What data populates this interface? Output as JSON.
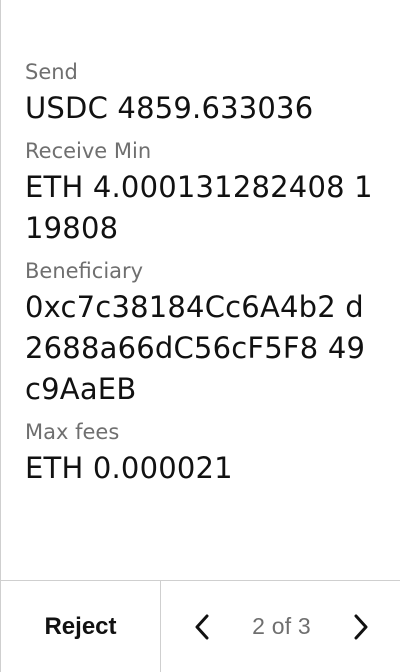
{
  "transaction": {
    "fields": [
      {
        "label": "Send",
        "value": "USDC 4859.633036"
      },
      {
        "label": "Receive Min",
        "value": "ETH 4.000131282408 119808"
      },
      {
        "label": "Beneficiary",
        "value": "0xc7c38184Cc6A4b2 d2688a66dC56cF5F8 49c9AaEB"
      },
      {
        "label": "Max fees",
        "value": "ETH 0.000021"
      }
    ]
  },
  "footer": {
    "reject_label": "Reject",
    "page_indicator": "2 of 3",
    "prev_icon": "chevron-left-icon",
    "next_icon": "chevron-right-icon"
  }
}
